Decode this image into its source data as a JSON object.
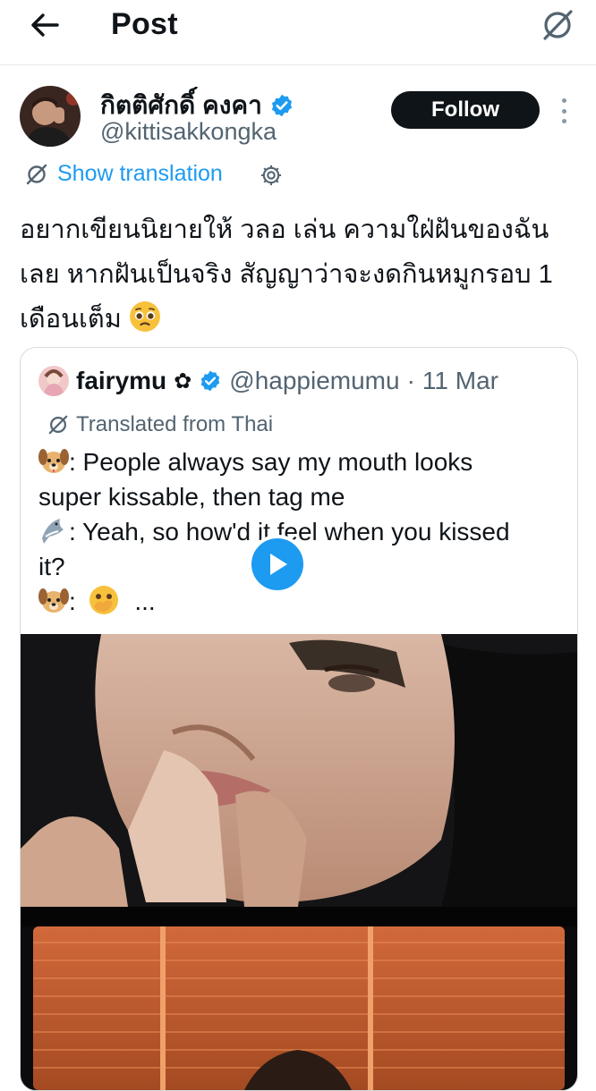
{
  "header": {
    "title": "Post",
    "back_icon": "arrow-left-icon",
    "grok_icon": "slashed-circle-icon"
  },
  "post": {
    "author_name": "กิตติศักดิ์ คงคา",
    "author_handle": "@kittisakkongka",
    "follow_label": "Follow",
    "show_translation": "Show translation",
    "text": "อยากเขียนนิยายให้ วลอ เล่น ความใฝ่ฝันของฉันเลย หากฝันเป็นจริง สัญญาว่าจะงดกินหมูกรอบ 1 เดือนเต็ม",
    "trailing_emoji": "pleading-face-emoji"
  },
  "quote": {
    "name": "fairymu",
    "name_flower": "✿",
    "handle": "@happiemumu",
    "separator": "·",
    "date": "11 Mar",
    "translated_label": "Translated from Thai",
    "line1": ": People always say my mouth looks",
    "line2": "super kissable, then tag me",
    "line3": ": Yeah, so how'd it feel when you kissed",
    "line4": "it?",
    "line5_dots": "...",
    "media": {
      "type": "video",
      "play_icon": "play-icon"
    }
  },
  "colors": {
    "accent": "#1d9bf0",
    "text": "#0f1419",
    "secondary": "#536471",
    "border": "#d4dbe1"
  }
}
